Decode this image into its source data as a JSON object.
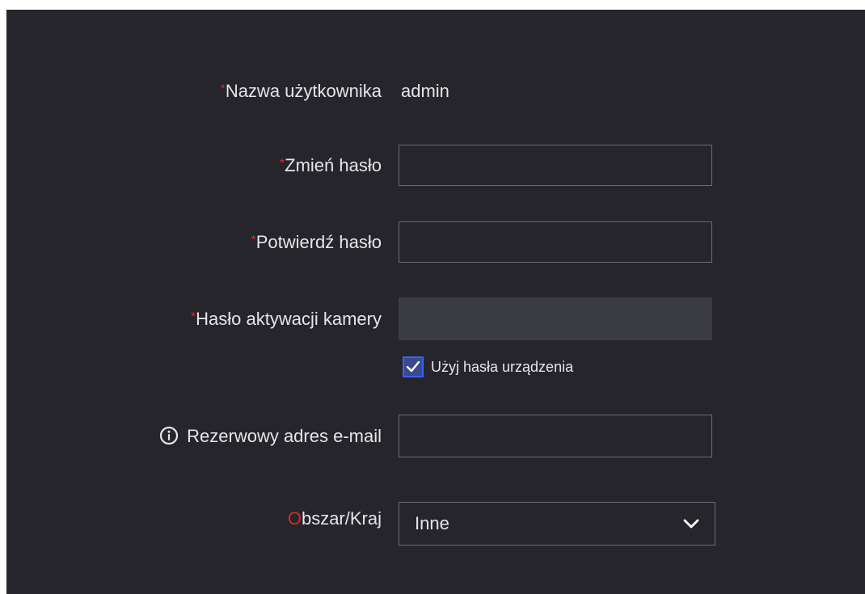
{
  "form": {
    "username": {
      "required_mark": "*",
      "label": "Nazwa użytkownika",
      "value": "admin"
    },
    "new_password": {
      "required_mark": "*",
      "label": "Zmień hasło",
      "value": ""
    },
    "confirm_password": {
      "required_mark": "*",
      "label": "Potwierdź hasło",
      "value": ""
    },
    "camera_activation_password": {
      "required_mark": "*",
      "label": "Hasło aktywacji kamery",
      "value": "",
      "disabled": true
    },
    "use_device_password": {
      "label": "Użyj hasła urządzenia",
      "checked": true
    },
    "backup_email": {
      "icon": "info-icon",
      "label": "Rezerwowy adres e-mail",
      "value": ""
    },
    "region": {
      "label_first": "O",
      "label_rest": "bszar/Kraj",
      "selected": "Inne",
      "icon": "chevron-down-icon"
    }
  },
  "colors": {
    "background": "#25252b",
    "required": "#d8262e",
    "checkbox_accent": "#3a62ff",
    "field_border": "#6c6c72",
    "disabled_field": "#3b3b42"
  }
}
